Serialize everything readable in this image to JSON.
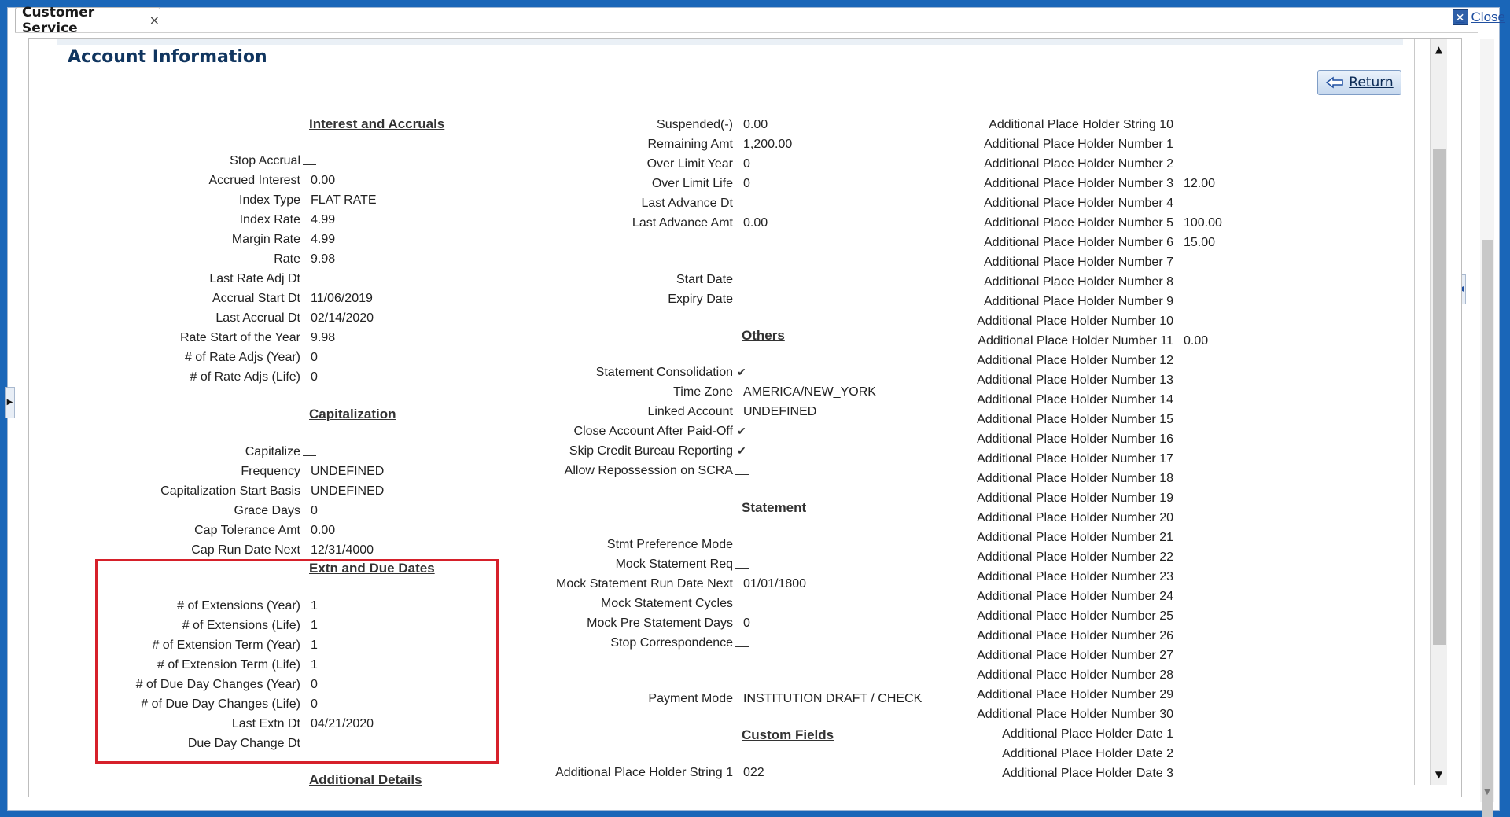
{
  "tab": {
    "label": "Customer Service",
    "close_glyph": "×"
  },
  "window": {
    "close_label": "Close"
  },
  "page": {
    "title": "Account Information",
    "return_label": "Return"
  },
  "col1": {
    "interest": {
      "heading": "Interest and Accruals",
      "fields": [
        {
          "label": "Stop Accrual",
          "value": "",
          "type": "blank"
        },
        {
          "label": "Accrued Interest",
          "value": "0.00"
        },
        {
          "label": "Index Type",
          "value": "FLAT RATE"
        },
        {
          "label": "Index Rate",
          "value": "4.99"
        },
        {
          "label": "Margin Rate",
          "value": "4.99"
        },
        {
          "label": "Rate",
          "value": "9.98"
        },
        {
          "label": "Last Rate Adj Dt",
          "value": ""
        },
        {
          "label": "Accrual Start Dt",
          "value": "11/06/2019"
        },
        {
          "label": "Last Accrual Dt",
          "value": "02/14/2020"
        },
        {
          "label": "Rate Start of the Year",
          "value": "9.98"
        },
        {
          "label": "# of Rate Adjs (Year)",
          "value": "0"
        },
        {
          "label": "# of Rate Adjs (Life)",
          "value": "0"
        }
      ]
    },
    "capitalization": {
      "heading": "Capitalization",
      "fields": [
        {
          "label": "Capitalize",
          "value": "",
          "type": "blank"
        },
        {
          "label": "Frequency",
          "value": "UNDEFINED"
        },
        {
          "label": "Capitalization Start Basis",
          "value": "UNDEFINED"
        },
        {
          "label": "Grace Days",
          "value": "0"
        },
        {
          "label": "Cap Tolerance Amt",
          "value": "0.00"
        },
        {
          "label": "Cap Run Date Next",
          "value": "12/31/4000"
        }
      ]
    },
    "extn": {
      "heading": "Extn and Due Dates",
      "fields": [
        {
          "label": "# of Extensions (Year)",
          "value": "1"
        },
        {
          "label": "# of Extensions (Life)",
          "value": "1"
        },
        {
          "label": "# of Extension Term (Year)",
          "value": "1"
        },
        {
          "label": "# of Extension Term (Life)",
          "value": "1"
        },
        {
          "label": "# of Due Day Changes (Year)",
          "value": "0"
        },
        {
          "label": "# of Due Day Changes (Life)",
          "value": "0"
        },
        {
          "label": "Last Extn Dt",
          "value": "04/21/2020"
        },
        {
          "label": "Due Day Change Dt",
          "value": ""
        }
      ]
    },
    "additional_heading": "Additional Details"
  },
  "col2": {
    "top_fields": [
      {
        "label": "Suspended(-)",
        "value": "0.00"
      },
      {
        "label": "Remaining Amt",
        "value": "1,200.00"
      },
      {
        "label": "Over Limit Year",
        "value": "0"
      },
      {
        "label": "Over Limit Life",
        "value": "0"
      },
      {
        "label": "Last Advance Dt",
        "value": ""
      },
      {
        "label": "Last Advance Amt",
        "value": "0.00"
      }
    ],
    "date_fields": [
      {
        "label": "Start Date",
        "value": ""
      },
      {
        "label": "Expiry Date",
        "value": ""
      }
    ],
    "others": {
      "heading": "Others",
      "fields": [
        {
          "label": "Statement Consolidation",
          "value": "✔",
          "type": "check"
        },
        {
          "label": "Time Zone",
          "value": "AMERICA/NEW_YORK"
        },
        {
          "label": "Linked Account",
          "value": "UNDEFINED"
        },
        {
          "label": "Close Account After Paid-Off",
          "value": "✔",
          "type": "check"
        },
        {
          "label": "Skip Credit Bureau Reporting",
          "value": "✔",
          "type": "check"
        },
        {
          "label": "Allow Repossession on SCRA",
          "value": "",
          "type": "blank"
        }
      ]
    },
    "statement": {
      "heading": "Statement",
      "fields": [
        {
          "label": "Stmt Preference Mode",
          "value": ""
        },
        {
          "label": "Mock Statement Req",
          "value": "",
          "type": "blank"
        },
        {
          "label": "Mock Statement Run Date Next",
          "value": "01/01/1800"
        },
        {
          "label": "Mock Statement Cycles",
          "value": ""
        },
        {
          "label": "Mock Pre Statement Days",
          "value": "0"
        },
        {
          "label": "Stop Correspondence",
          "value": "",
          "type": "blank"
        }
      ]
    },
    "payment": {
      "label": "Payment Mode",
      "value": "INSTITUTION DRAFT / CHECK"
    },
    "custom": {
      "heading": "Custom Fields",
      "fields": [
        {
          "label": "Additional Place Holder String 1",
          "value": "022"
        }
      ]
    }
  },
  "col3": {
    "fields": [
      {
        "label": "Additional Place Holder String 10",
        "value": ""
      },
      {
        "label": "Additional Place Holder Number 1",
        "value": ""
      },
      {
        "label": "Additional Place Holder Number 2",
        "value": ""
      },
      {
        "label": "Additional Place Holder Number 3",
        "value": "12.00"
      },
      {
        "label": "Additional Place Holder Number 4",
        "value": ""
      },
      {
        "label": "Additional Place Holder Number 5",
        "value": "100.00"
      },
      {
        "label": "Additional Place Holder Number 6",
        "value": "15.00"
      },
      {
        "label": "Additional Place Holder Number 7",
        "value": ""
      },
      {
        "label": "Additional Place Holder Number 8",
        "value": ""
      },
      {
        "label": "Additional Place Holder Number 9",
        "value": ""
      },
      {
        "label": "Additional Place Holder Number 10",
        "value": ""
      },
      {
        "label": "Additional Place Holder Number 11",
        "value": "0.00"
      },
      {
        "label": "Additional Place Holder Number 12",
        "value": ""
      },
      {
        "label": "Additional Place Holder Number 13",
        "value": ""
      },
      {
        "label": "Additional Place Holder Number 14",
        "value": ""
      },
      {
        "label": "Additional Place Holder Number 15",
        "value": ""
      },
      {
        "label": "Additional Place Holder Number 16",
        "value": ""
      },
      {
        "label": "Additional Place Holder Number 17",
        "value": ""
      },
      {
        "label": "Additional Place Holder Number 18",
        "value": ""
      },
      {
        "label": "Additional Place Holder Number 19",
        "value": ""
      },
      {
        "label": "Additional Place Holder Number 20",
        "value": ""
      },
      {
        "label": "Additional Place Holder Number 21",
        "value": ""
      },
      {
        "label": "Additional Place Holder Number 22",
        "value": ""
      },
      {
        "label": "Additional Place Holder Number 23",
        "value": ""
      },
      {
        "label": "Additional Place Holder Number 24",
        "value": ""
      },
      {
        "label": "Additional Place Holder Number 25",
        "value": ""
      },
      {
        "label": "Additional Place Holder Number 26",
        "value": ""
      },
      {
        "label": "Additional Place Holder Number 27",
        "value": ""
      },
      {
        "label": "Additional Place Holder Number 28",
        "value": ""
      },
      {
        "label": "Additional Place Holder Number 29",
        "value": ""
      },
      {
        "label": "Additional Place Holder Number 30",
        "value": ""
      },
      {
        "label": "Additional Place Holder Date 1",
        "value": ""
      },
      {
        "label": "Additional Place Holder Date 2",
        "value": ""
      },
      {
        "label": "Additional Place Holder Date 3",
        "value": ""
      }
    ]
  },
  "colors": {
    "title": "#10355f",
    "highlight": "#d6202a",
    "frame": "#1a66b8"
  },
  "icons": {
    "tab_close": "close-icon",
    "window_close": "close-box-icon",
    "return": "arrow-left-icon"
  }
}
